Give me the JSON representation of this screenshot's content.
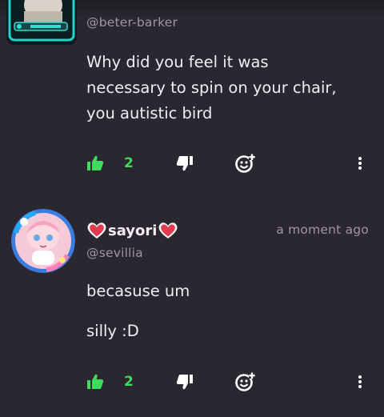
{
  "comments": [
    {
      "handle": "@beter-barker",
      "text_lines": [
        "Why did you feel it was",
        "necessary to spin on your chair,",
        "you autistic bird"
      ],
      "likes": "2"
    },
    {
      "username": "sayori",
      "handle": "@sevillia",
      "time": "a moment ago",
      "text_lines": [
        "becasuse um",
        "silly :D"
      ],
      "likes": "2"
    }
  ],
  "colors": {
    "background": "#2b2730",
    "like_active": "#3ddc5a",
    "muted": "#9d97a3",
    "heart_emoji": "#e23a4e"
  },
  "icons": [
    "thumbs-up-icon",
    "thumbs-down-icon",
    "add-reaction-icon",
    "more-options-icon",
    "heart-emoji-icon"
  ]
}
